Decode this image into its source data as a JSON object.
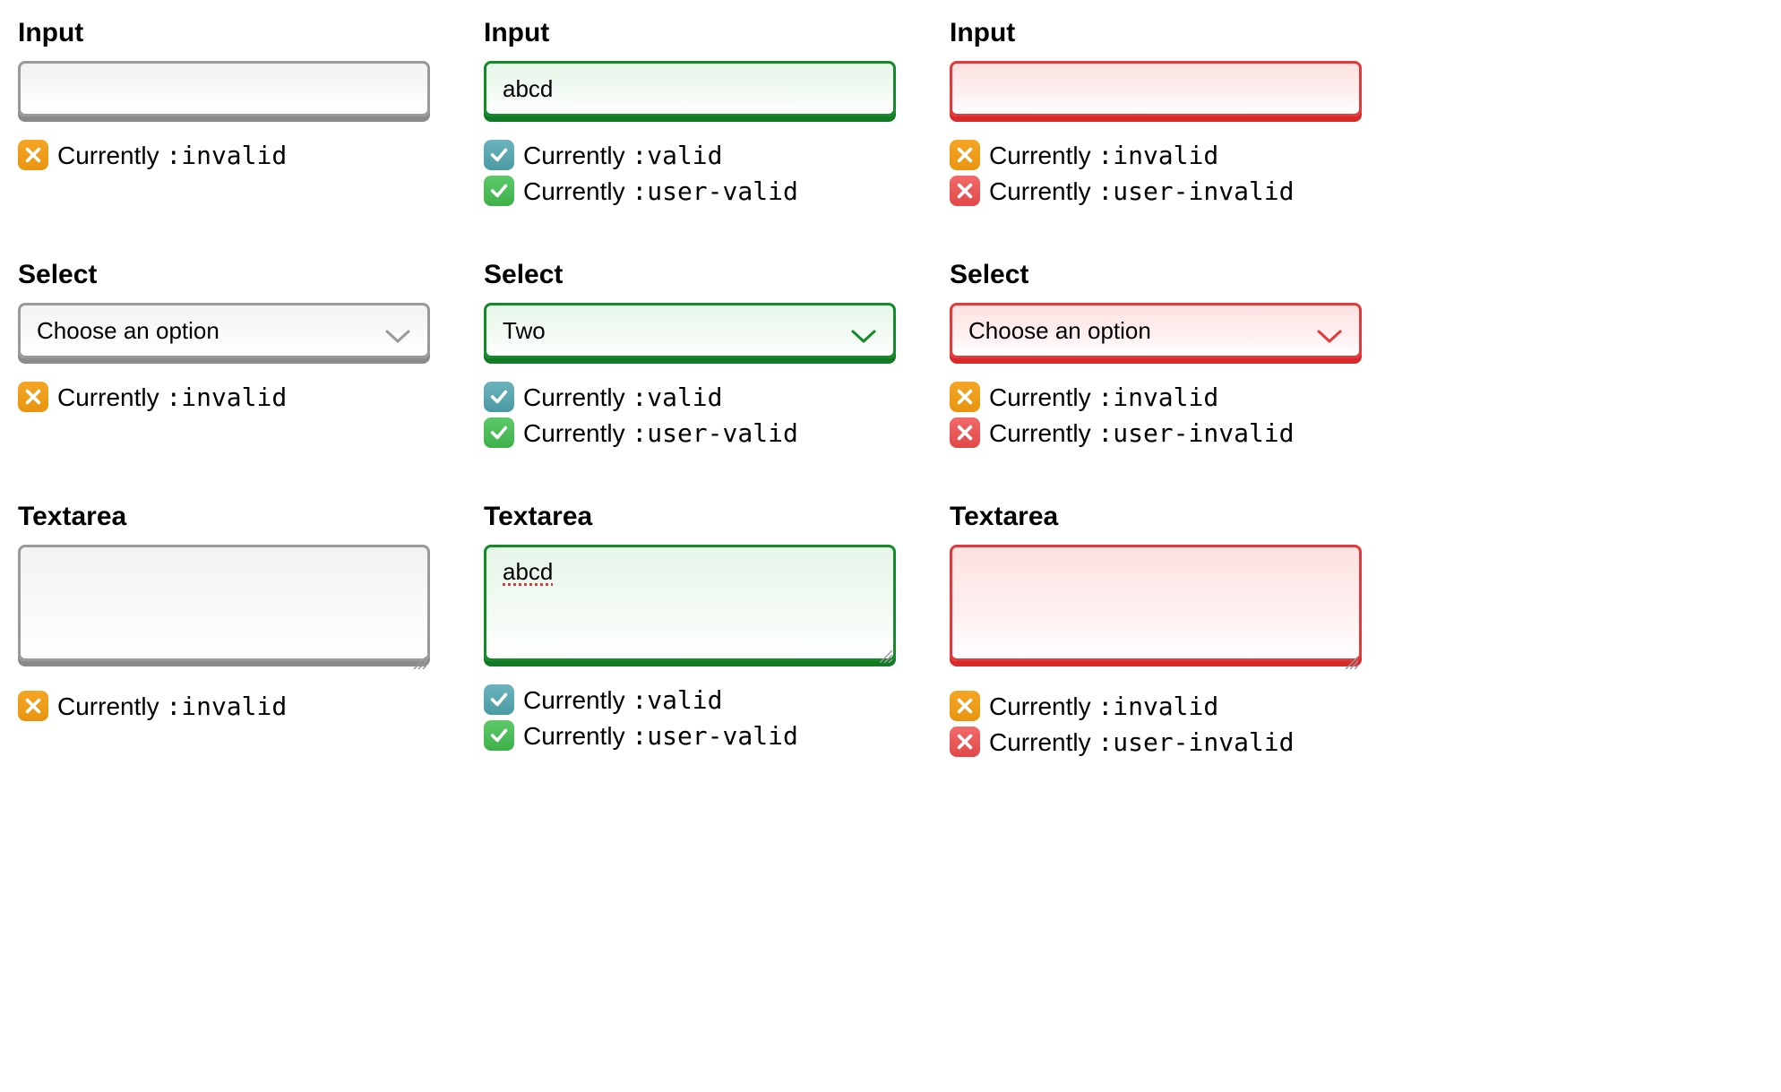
{
  "labels": {
    "input": "Input",
    "select": "Select",
    "textarea": "Textarea"
  },
  "status_prefix": "Currently ",
  "states": {
    "invalid": ":invalid",
    "valid": ":valid",
    "user_valid": ":user-valid",
    "user_invalid": ":user-invalid"
  },
  "placeholders": {
    "choose": "Choose an option"
  },
  "values": {
    "input_col2": "abcd",
    "input_col3": "",
    "select_col2": "Two",
    "textarea_col2": "abcd",
    "textarea_col3": ""
  }
}
